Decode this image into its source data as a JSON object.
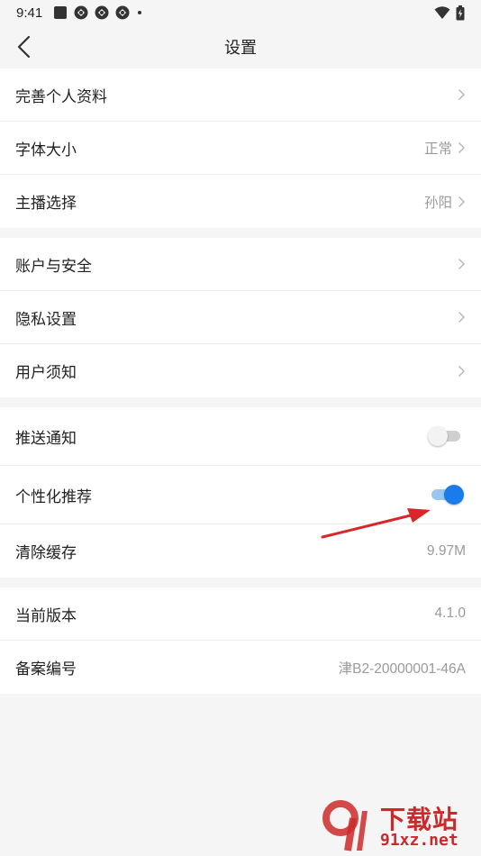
{
  "status_bar": {
    "time": "9:41",
    "icons": [
      "stop-square-icon",
      "app-notification-icon",
      "app-notification-icon",
      "app-notification-icon",
      "more-dot-icon"
    ],
    "right_icons": [
      "wifi-icon",
      "battery-charging-icon"
    ]
  },
  "header": {
    "title": "设置",
    "back_icon": "back-chevron-icon"
  },
  "groups": [
    {
      "rows": [
        {
          "label": "完善个人资料",
          "value": ""
        },
        {
          "label": "字体大小",
          "value": "正常"
        },
        {
          "label": "主播选择",
          "value": "孙阳"
        }
      ]
    },
    {
      "rows": [
        {
          "label": "账户与安全",
          "value": ""
        },
        {
          "label": "隐私设置",
          "value": ""
        },
        {
          "label": "用户须知",
          "value": ""
        }
      ]
    },
    {
      "rows": [
        {
          "label": "推送通知",
          "toggle": false
        },
        {
          "label": "个性化推荐",
          "toggle": true
        },
        {
          "label": "清除缓存",
          "value": "9.97M"
        }
      ]
    },
    {
      "rows": [
        {
          "label": "当前版本",
          "value": "4.1.0"
        },
        {
          "label": "备案编号",
          "value": "津B2-20000001-46A"
        }
      ]
    }
  ],
  "colors": {
    "accent": "#1a7bea",
    "annotation_arrow": "#d8262a",
    "page_bg": "#f5f5f6"
  },
  "watermark": {
    "top": "下载站",
    "bottom": "91xz.net"
  }
}
